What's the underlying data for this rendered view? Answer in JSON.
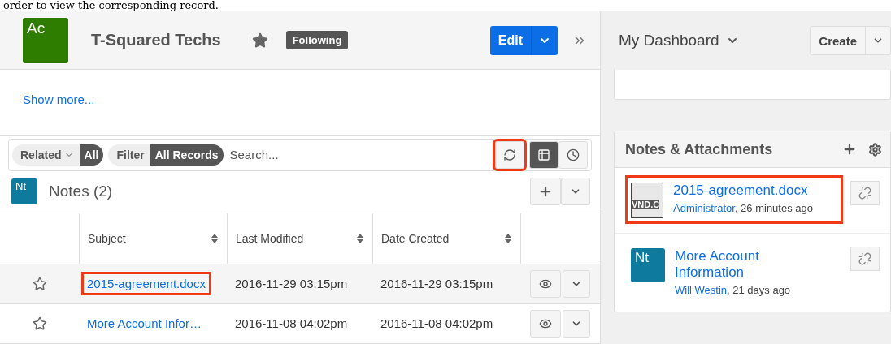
{
  "caption": "order to view the corresponding record.",
  "record": {
    "avatar": "Ac",
    "name": "T-Squared Techs",
    "favorite": true,
    "following": "Following",
    "edit": "Edit"
  },
  "show_more": "Show more...",
  "toolbar": {
    "related": "Related",
    "related_value": "All",
    "filter": "Filter",
    "filter_value": "All Records",
    "search_placeholder": "Search...",
    "refresh_highlighted": true,
    "list_view_selected": true
  },
  "subpanel": {
    "avatar": "Nt",
    "title": "Notes (2)"
  },
  "table": {
    "columns": [
      "Subject",
      "Last Modified",
      "Date Created"
    ],
    "rows": [
      {
        "subject": "2015-agreement.docx",
        "modified": "2016-11-29 03:15pm",
        "created": "2016-11-29 03:15pm",
        "favorite": false,
        "highlighted": true
      },
      {
        "subject": "More Account Infor…",
        "modified": "2016-11-08 04:02pm",
        "created": "2016-11-08 04:02pm",
        "favorite": false,
        "highlighted": false
      }
    ]
  },
  "dashboard": {
    "title": "My Dashboard",
    "create": "Create"
  },
  "dashlet": {
    "title": "Notes & Attachments",
    "items": [
      {
        "kind": "file",
        "icon_text": "VND.C",
        "title": "2015-agreement.docx",
        "author": "Administrator",
        "time": ", 26 minutes ago",
        "highlighted": true
      },
      {
        "kind": "note",
        "icon_text": "Nt",
        "title": "More Account Information",
        "author": "Will Westin",
        "time": ", 21 days ago",
        "highlighted": false
      }
    ]
  }
}
